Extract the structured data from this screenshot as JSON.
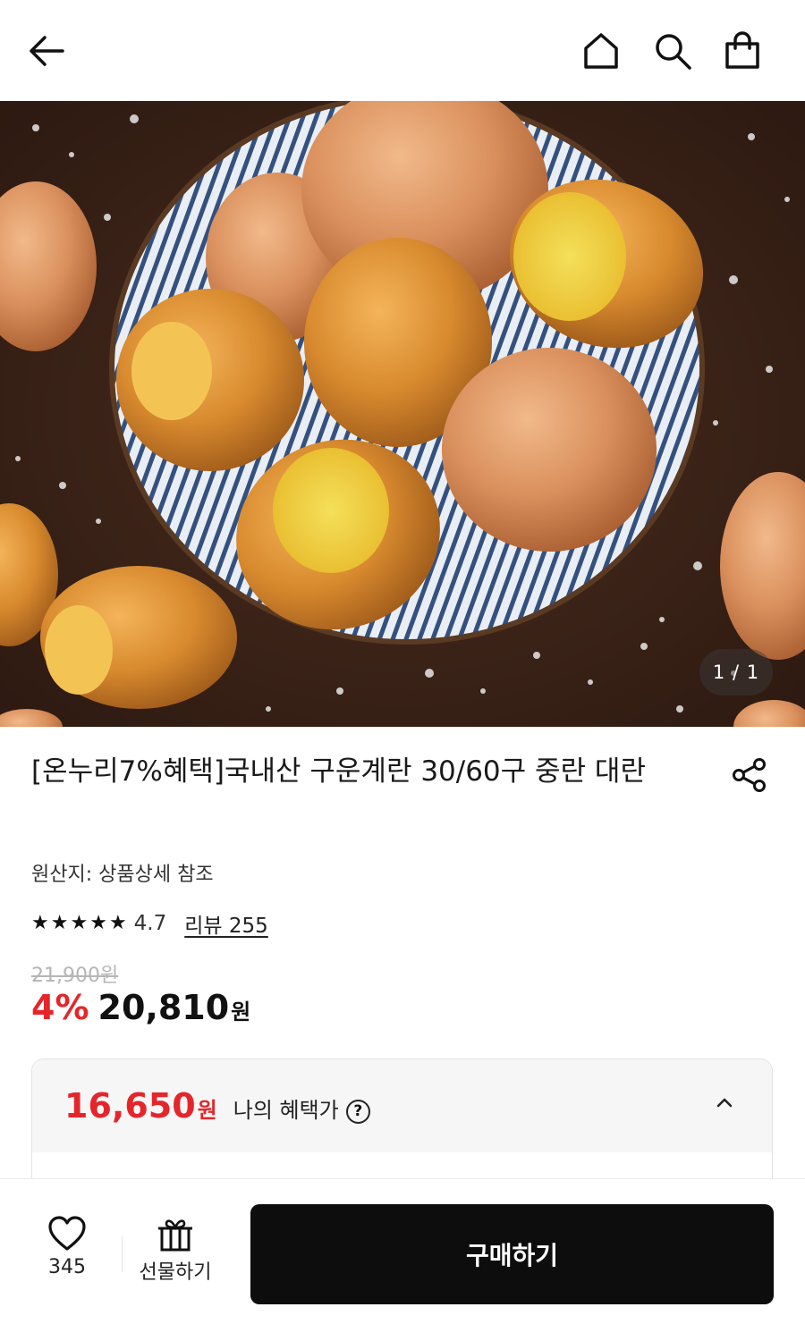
{
  "header": {
    "back_icon": "arrow-left-icon",
    "home_icon": "home-icon",
    "search_icon": "search-icon",
    "cart_icon": "shopping-bag-icon"
  },
  "gallery": {
    "counter": "1 / 1",
    "image_subject": "soy-braised baked eggs in a striped bowl with coarse salt"
  },
  "product": {
    "title": "[온누리7%혜택]국내산 구운계란 30/60구 중란 대란",
    "origin": "원산지: 상품상세 참조",
    "rating": "4.7",
    "stars": 4.7,
    "review_link": "리뷰 255",
    "original_price": "21,900원",
    "discount": "4%",
    "price": "20,810",
    "currency": "원"
  },
  "benefit": {
    "price": "16,650",
    "currency": "원",
    "label": "나의 혜택가",
    "help_glyph": "?"
  },
  "bottom_bar": {
    "like_count": "345",
    "gift_label": "선물하기",
    "buy_label": "구매하기"
  },
  "colors": {
    "accent_red": "#e4262b",
    "buy_button": "#0d0d0d"
  }
}
